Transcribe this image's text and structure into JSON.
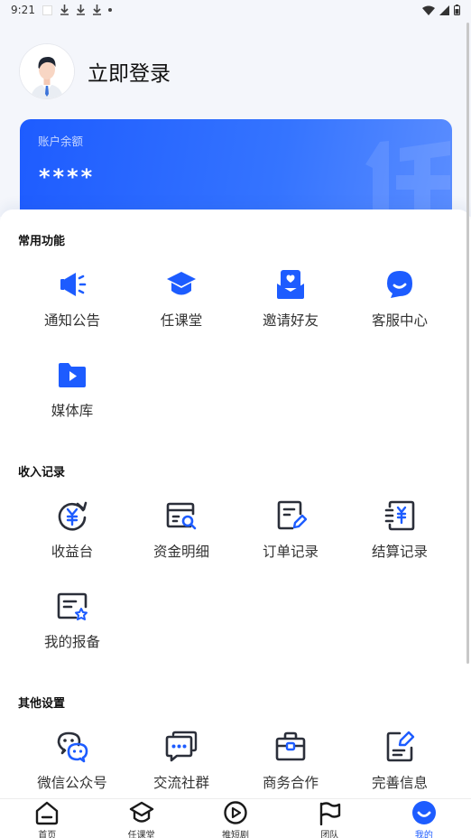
{
  "status_bar": {
    "time": "9:21"
  },
  "profile": {
    "login_text": "立即登录"
  },
  "balance": {
    "label": "账户余额",
    "value": "****"
  },
  "sections": {
    "common": {
      "title": "常用功能",
      "items": [
        {
          "label": "通知公告",
          "icon": "megaphone-icon"
        },
        {
          "label": "任课堂",
          "icon": "graduation-cap-icon"
        },
        {
          "label": "邀请好友",
          "icon": "invite-envelope-icon"
        },
        {
          "label": "客服中心",
          "icon": "customer-service-icon"
        },
        {
          "label": "媒体库",
          "icon": "media-folder-icon"
        }
      ]
    },
    "income": {
      "title": "收入记录",
      "items": [
        {
          "label": "收益台",
          "icon": "yuan-refresh-icon"
        },
        {
          "label": "资金明细",
          "icon": "fund-details-icon"
        },
        {
          "label": "订单记录",
          "icon": "order-record-icon"
        },
        {
          "label": "结算记录",
          "icon": "settlement-record-icon"
        },
        {
          "label": "我的报备",
          "icon": "my-report-icon"
        }
      ]
    },
    "other": {
      "title": "其他设置",
      "items": [
        {
          "label": "微信公众号",
          "icon": "wechat-icon"
        },
        {
          "label": "交流社群",
          "icon": "community-chat-icon"
        },
        {
          "label": "商务合作",
          "icon": "briefcase-icon"
        },
        {
          "label": "完善信息",
          "icon": "edit-info-icon"
        }
      ]
    }
  },
  "tab_bar": {
    "tabs": [
      {
        "label": "首页",
        "icon": "home-icon"
      },
      {
        "label": "任课堂",
        "icon": "graduation-cap-icon"
      },
      {
        "label": "推短剧",
        "icon": "play-icon"
      },
      {
        "label": "团队",
        "icon": "flag-icon"
      },
      {
        "label": "我的",
        "icon": "profile-smile-icon",
        "active": true
      }
    ]
  },
  "colors": {
    "accent": "#1D5CFF",
    "icon_dark": "#2B2F3A",
    "background": "#F4F6FB"
  }
}
